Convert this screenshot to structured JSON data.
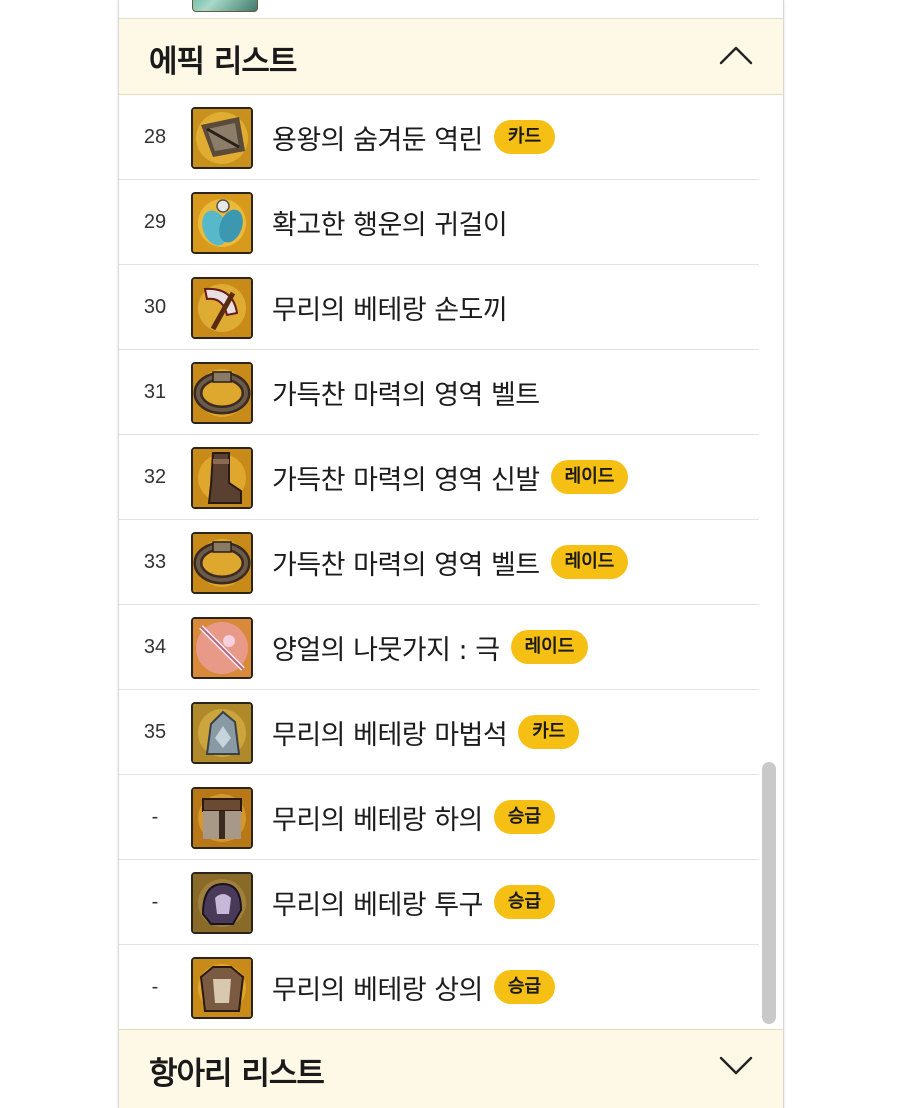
{
  "epic_section": {
    "title": "에픽 리스트",
    "expanded": true,
    "items": [
      {
        "rank": "28",
        "name": "용왕의 숨겨둔 역린",
        "badge": "카드",
        "icon": "scale-armor-icon"
      },
      {
        "rank": "29",
        "name": "확고한 행운의 귀걸이",
        "badge": "",
        "icon": "wing-earring-icon"
      },
      {
        "rank": "30",
        "name": "무리의 베테랑 손도끼",
        "badge": "",
        "icon": "hand-axe-icon"
      },
      {
        "rank": "31",
        "name": "가득찬 마력의 영역 벨트",
        "badge": "",
        "icon": "belt-icon"
      },
      {
        "rank": "32",
        "name": "가득찬 마력의 영역 신발",
        "badge": "레이드",
        "icon": "boots-icon"
      },
      {
        "rank": "33",
        "name": "가득찬 마력의 영역 벨트",
        "badge": "레이드",
        "icon": "belt-icon"
      },
      {
        "rank": "34",
        "name": "양얼의 나뭇가지 : 극",
        "badge": "레이드",
        "icon": "magic-branch-icon"
      },
      {
        "rank": "35",
        "name": "무리의 베테랑 마법석",
        "badge": "카드",
        "icon": "magic-stone-icon"
      },
      {
        "rank": "-",
        "name": "무리의 베테랑 하의",
        "badge": "승급",
        "icon": "pants-icon"
      },
      {
        "rank": "-",
        "name": "무리의 베테랑 투구",
        "badge": "승급",
        "icon": "helmet-icon"
      },
      {
        "rank": "-",
        "name": "무리의 베테랑 상의",
        "badge": "승급",
        "icon": "chest-armor-icon"
      }
    ]
  },
  "jar_section": {
    "title": "항아리 리스트",
    "expanded": false
  },
  "colors": {
    "badge": "#f6bf14",
    "header_bg": "#fef8e6",
    "row_divider": "#e2e2e2",
    "scrollbar": "#c9c9c9"
  }
}
